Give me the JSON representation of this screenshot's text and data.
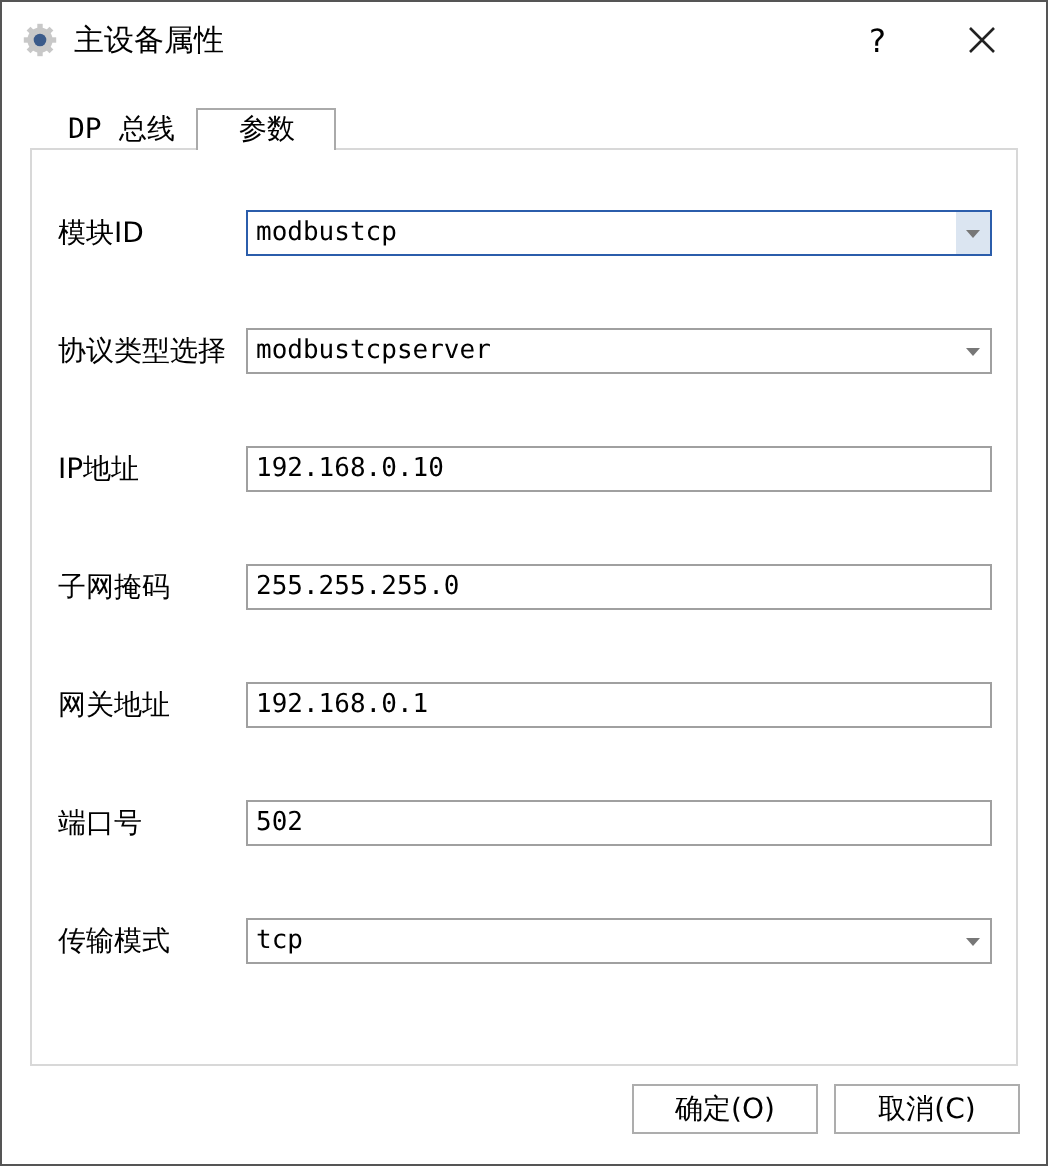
{
  "window": {
    "title": "主设备属性",
    "help": "?"
  },
  "tabs": [
    {
      "label": "DP 总线",
      "selected": false
    },
    {
      "label": "参数",
      "selected": true
    }
  ],
  "fields": [
    {
      "label": "模块ID",
      "value": "modbustcp",
      "kind": "dropdown",
      "focused": true
    },
    {
      "label": "协议类型选择",
      "value": "modbustcpserver",
      "kind": "dropdown",
      "focused": false
    },
    {
      "label": "IP地址",
      "value": "192.168.0.10",
      "kind": "text",
      "focused": false
    },
    {
      "label": "子网掩码",
      "value": "255.255.255.0",
      "kind": "text",
      "focused": false
    },
    {
      "label": "网关地址",
      "value": "192.168.0.1",
      "kind": "text",
      "focused": false
    },
    {
      "label": "端口号",
      "value": "502",
      "kind": "text",
      "focused": false
    },
    {
      "label": "传输模式",
      "value": "tcp",
      "kind": "dropdown",
      "focused": false
    }
  ],
  "buttons": [
    "确定(O)",
    "取消(C)"
  ]
}
